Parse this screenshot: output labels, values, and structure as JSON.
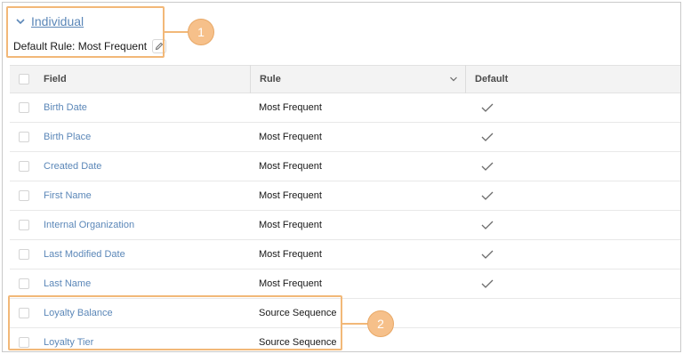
{
  "section": {
    "title": "Individual",
    "default_rule": "Default Rule: Most Frequent"
  },
  "table": {
    "headers": {
      "field": "Field",
      "rule": "Rule",
      "default": "Default"
    },
    "rows": [
      {
        "field": "Birth Date",
        "rule": "Most Frequent",
        "default": true
      },
      {
        "field": "Birth Place",
        "rule": "Most Frequent",
        "default": true
      },
      {
        "field": "Created Date",
        "rule": "Most Frequent",
        "default": true
      },
      {
        "field": "First Name",
        "rule": "Most Frequent",
        "default": true
      },
      {
        "field": "Internal Organization",
        "rule": "Most Frequent",
        "default": true
      },
      {
        "field": "Last Modified Date",
        "rule": "Most Frequent",
        "default": true
      },
      {
        "field": "Last Name",
        "rule": "Most Frequent",
        "default": true
      },
      {
        "field": "Loyalty Balance",
        "rule": "Source Sequence",
        "default": false
      },
      {
        "field": "Loyalty Tier",
        "rule": "Source Sequence",
        "default": false
      }
    ]
  },
  "callouts": {
    "first": "1",
    "second": "2"
  },
  "colors": {
    "accent": "#f2b878",
    "link": "#5b87b8"
  }
}
